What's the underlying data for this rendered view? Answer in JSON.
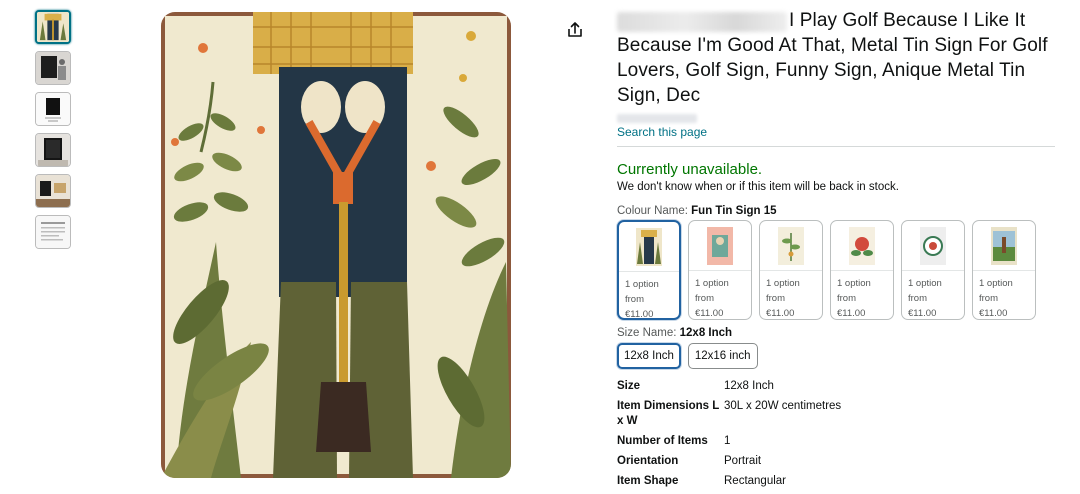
{
  "title": {
    "text": "I Play Golf Because I Like It Because I'm Good At That, Metal Tin Sign For Golf Lovers, Golf Sign, Funny Sign, Anique Metal Tin Sign, Dec"
  },
  "search_link": "Search this page",
  "availability": {
    "status": "Currently unavailable.",
    "note": "We don't know when or if this item will be back in stock."
  },
  "colour": {
    "label": "Colour Name:",
    "value": "Fun Tin Sign 15",
    "swatches": [
      {
        "line1": "1 option",
        "line2": "from",
        "price": "€11.00"
      },
      {
        "line1": "1 option",
        "line2": "from",
        "price": "€11.00"
      },
      {
        "line1": "1 option",
        "line2": "from",
        "price": "€11.00"
      },
      {
        "line1": "1 option",
        "line2": "from",
        "price": "€11.00"
      },
      {
        "line1": "1 option",
        "line2": "from",
        "price": "€11.00"
      },
      {
        "line1": "1 option",
        "line2": "from",
        "price": "€11.00"
      }
    ]
  },
  "size": {
    "label": "Size Name:",
    "value": "12x8 Inch",
    "options": [
      "12x8 Inch",
      "12x16 inch"
    ]
  },
  "specs": [
    {
      "key": "Size",
      "value": "12x8 Inch"
    },
    {
      "key": "Item Dimensions L x W",
      "value": "30L x 20W centimetres"
    },
    {
      "key": "Number of Items",
      "value": "1"
    },
    {
      "key": "Orientation",
      "value": "Portrait"
    },
    {
      "key": "Item Shape",
      "value": "Rectangular"
    }
  ],
  "icons": {
    "share": "share-icon"
  },
  "colors": {
    "link": "#007185",
    "available_green": "#007600",
    "selected_border": "#2162a1"
  }
}
